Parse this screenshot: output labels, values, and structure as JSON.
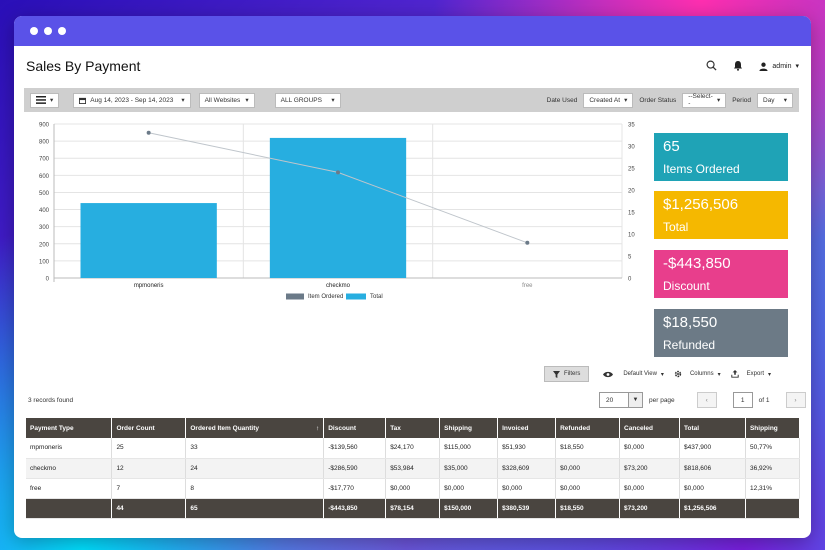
{
  "app": {
    "page_title": "Sales By Payment",
    "admin_label": "admin"
  },
  "toolbar": {
    "date_range": "Aug 14, 2023 - Sep 14, 2023",
    "websites": "All Websites",
    "groups": "ALL GROUPS",
    "date_used_label": "Date Used",
    "date_used_value": "Created At",
    "order_status_label": "Order Status",
    "order_status_value": "--Select--",
    "period_label": "Period",
    "period_value": "Day"
  },
  "chart_data": {
    "type": "bar",
    "categories": [
      "mpmoneris",
      "checkmo",
      "free"
    ],
    "series": [
      {
        "name": "Item Ordered",
        "type": "line",
        "axis": "right",
        "values": [
          33,
          24,
          8
        ],
        "color": "#6b7a88"
      },
      {
        "name": "Total",
        "type": "bar",
        "axis": "left",
        "values": [
          437.9,
          818.7,
          0
        ],
        "color": "#27aee0"
      }
    ],
    "left_axis": {
      "ticks": [
        "0",
        "100",
        "200",
        "300",
        "400",
        "500",
        "600",
        "700",
        "800",
        "900"
      ],
      "max": 900
    },
    "right_axis": {
      "ticks": [
        "0",
        "5",
        "10",
        "15",
        "20",
        "25",
        "30",
        "35"
      ],
      "max": 35
    },
    "legend_position": "bottom",
    "grid": true
  },
  "stats": [
    {
      "value": "65",
      "label": "Items Ordered",
      "color": "#1fa3b6"
    },
    {
      "value": "$1,256,506",
      "label": "Total",
      "color": "#f5b800"
    },
    {
      "value": "-$443,850",
      "label": "Discount",
      "color": "#e83e8c"
    },
    {
      "value": "$18,550",
      "label": "Refunded",
      "color": "#6c7a86"
    }
  ],
  "grid_controls": {
    "filters": "Filters",
    "default_view": "Default View",
    "columns": "Columns",
    "export": "Export",
    "records_found": "3 records found",
    "per_page_value": "20",
    "per_page_label": "per page",
    "page_current": "1",
    "page_of": "of 1"
  },
  "table": {
    "headers": [
      "Payment Type",
      "Order Count",
      "Ordered Item Quantity",
      "Discount",
      "Tax",
      "Shipping",
      "Invoiced",
      "Refunded",
      "Canceled",
      "Total",
      "Shipping"
    ],
    "sort_arrow": "↑",
    "rows": [
      [
        "mpmoneris",
        "25",
        "33",
        "-$139,560",
        "$24,170",
        "$115,000",
        "$51,930",
        "$18,550",
        "$0,000",
        "$437,900",
        "50,77%"
      ],
      [
        "checkmo",
        "12",
        "24",
        "-$286,590",
        "$53,984",
        "$35,000",
        "$328,609",
        "$0,000",
        "$73,200",
        "$818,606",
        "36,92%"
      ],
      [
        "free",
        "7",
        "8",
        "-$17,770",
        "$0,000",
        "$0,000",
        "$0,000",
        "$0,000",
        "$0,000",
        "$0,000",
        "12,31%"
      ]
    ],
    "footer": [
      "",
      "44",
      "65",
      "-$443,850",
      "$78,154",
      "$150,000",
      "$380,539",
      "$18,550",
      "$73,200",
      "$1,256,506",
      ""
    ]
  }
}
